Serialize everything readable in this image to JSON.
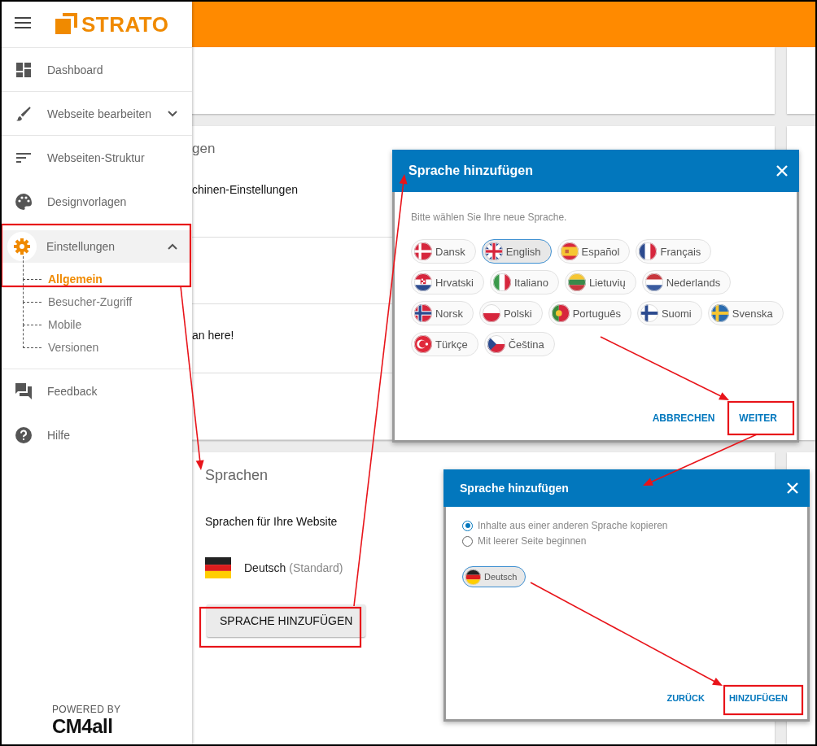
{
  "logo": "STRATO",
  "sidebar": {
    "items": [
      {
        "label": "Dashboard",
        "kind": "dashboard",
        "selected": false
      },
      {
        "label": "Webseite bearbeiten",
        "kind": "brush",
        "selected": false,
        "expanded": false
      },
      {
        "label": "Webseiten-Struktur",
        "kind": "structure",
        "selected": false
      },
      {
        "label": "Designvorlagen",
        "kind": "palette",
        "selected": false
      },
      {
        "label": "Einstellungen",
        "kind": "gear",
        "selected": true,
        "expanded": true,
        "children": [
          {
            "label": "Allgemein",
            "selected": true
          },
          {
            "label": "Besucher-Zugriff",
            "selected": false
          },
          {
            "label": "Mobile",
            "selected": false
          },
          {
            "label": "Versionen",
            "selected": false
          }
        ]
      },
      {
        "label": "Feedback",
        "kind": "feedback",
        "selected": false
      },
      {
        "label": "Hilfe",
        "kind": "help",
        "selected": false
      }
    ],
    "footer": {
      "powered_by": "POWERED BY",
      "brand": "CM4all"
    }
  },
  "main": {
    "partial_section": {
      "heading": "gen",
      "rows": [
        "chinen-Einstellungen",
        "",
        "an here!",
        ""
      ]
    },
    "languages": {
      "heading": "Sprachen",
      "subtitle": "Sprachen für Ihre Website",
      "entries": [
        {
          "name": "Deutsch",
          "note": "(Standard)",
          "kind": "de"
        }
      ],
      "button": "SPRACHE HINZUFÜGEN"
    }
  },
  "dialogs": [
    {
      "title": "Sprache hinzufügen",
      "prompt": "Bitte wählen Sie Ihre neue Sprache.",
      "chips": [
        {
          "label": "Dansk",
          "kind": "dk",
          "selected": false
        },
        {
          "label": "English",
          "kind": "gb",
          "selected": true
        },
        {
          "label": "Español",
          "kind": "es",
          "selected": false
        },
        {
          "label": "Français",
          "kind": "fr",
          "selected": false
        },
        {
          "label": "Hrvatski",
          "kind": "hr",
          "selected": false
        },
        {
          "label": "Italiano",
          "kind": "it",
          "selected": false
        },
        {
          "label": "Lietuvių",
          "kind": "lt",
          "selected": false
        },
        {
          "label": "Nederlands",
          "kind": "nl",
          "selected": false
        },
        {
          "label": "Norsk",
          "kind": "no",
          "selected": false
        },
        {
          "label": "Polski",
          "kind": "pl",
          "selected": false
        },
        {
          "label": "Português",
          "kind": "pt",
          "selected": false
        },
        {
          "label": "Suomi",
          "kind": "fi",
          "selected": false
        },
        {
          "label": "Svenska",
          "kind": "se",
          "selected": false
        },
        {
          "label": "Türkçe",
          "kind": "tr",
          "selected": false
        },
        {
          "label": "Čeština",
          "kind": "cz",
          "selected": false
        }
      ],
      "buttons": [
        "ABBRECHEN",
        "WEITER"
      ]
    },
    {
      "title": "Sprache hinzufügen",
      "options": [
        {
          "label": "Inhalte aus einer anderen Sprache kopieren",
          "selected": true
        },
        {
          "label": "Mit leerer Seite beginnen",
          "selected": false
        }
      ],
      "chips": [
        {
          "label": "Deutsch",
          "kind": "de",
          "selected": true
        }
      ],
      "buttons": [
        "ZURÜCK",
        "HINZUFÜGEN"
      ]
    }
  ]
}
